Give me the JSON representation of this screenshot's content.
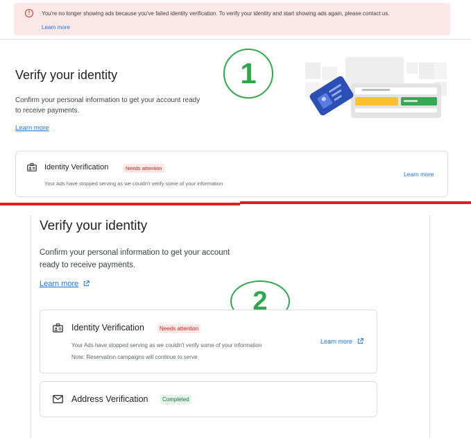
{
  "panel1": {
    "banner": {
      "message": "You're no longer showing ads because you've failed identity verification. To verify your identity and start showing ads again, please contact us.",
      "link": "Learn more"
    },
    "title": "Verify your identity",
    "description": "Confirm your personal information to get your account ready to receive payments.",
    "learn_more": "Learn more",
    "step_number": "1",
    "identity_card": {
      "title": "Identity Verification",
      "badge": "Needs attention",
      "subtitle": "Your Ads have stopped serving as we couldn't verify some of your information",
      "learn_more": "Learn more"
    }
  },
  "panel2": {
    "title": "Verify your identity",
    "description": "Confirm your personal information to get your account ready to receive payments.",
    "learn_more": "Learn more",
    "step_number": "2",
    "identity_card": {
      "title": "Identity Verification",
      "badge": "Needs attention",
      "subtitle": "Your Ads have stopped serving as we couldn't verify some of your information",
      "note": "Note: Reservation campaigns will continue to serve",
      "learn_more": "Learn more"
    },
    "address_card": {
      "title": "Address Verification",
      "badge": "Completed"
    }
  },
  "colors": {
    "link": "#1a73e8",
    "alert_red": "#d93025",
    "banner_bg": "#fce8e6",
    "success_green": "#137333",
    "annotation_green": "#2ea84a",
    "separator_red": "#e02020"
  },
  "icons": {
    "banner": "alert-circle-icon",
    "identity": "id-card-icon",
    "address": "mail-icon",
    "external": "external-link-icon"
  }
}
